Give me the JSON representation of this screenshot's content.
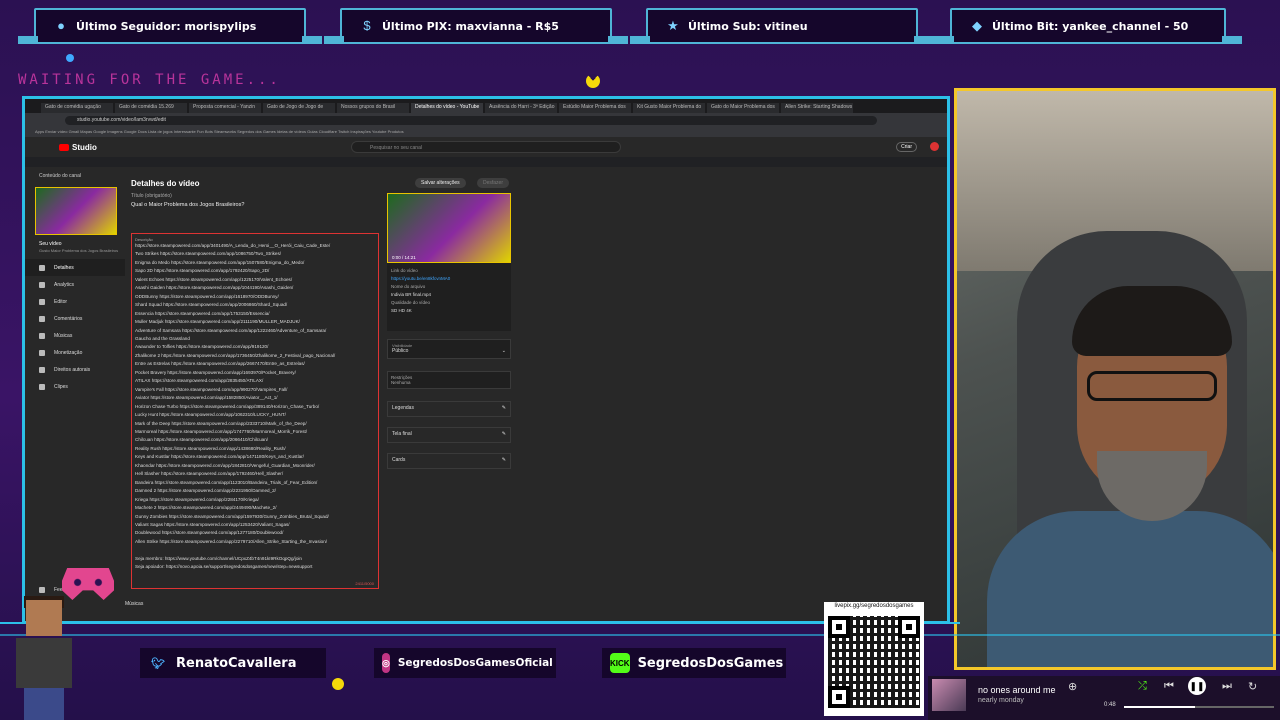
{
  "alerts": [
    {
      "icon": "user-icon",
      "text": "Último Seguidor: morispylips"
    },
    {
      "icon": "pix-icon",
      "text": "Último PIX: maxvianna - R$5"
    },
    {
      "icon": "star-icon",
      "text": "Último Sub: vitineu"
    },
    {
      "icon": "diamond-icon",
      "text": "Último Bit: yankee_channel - 50"
    }
  ],
  "status_text": "WAITING FOR THE GAME...",
  "browser": {
    "tabs": [
      "Gato de comédia ugação",
      "Gato de comédia 15.269",
      "Proposta comercial - Yanzin",
      "Gato de Jogo de Jogo de",
      "Nossos grupos do Brasil",
      "Detalhes do vídeo - YouTube",
      "Ausência do Harri - 3ª Edição",
      "Estúdio Maior Problema dos",
      "Kit Gusto Maior Problema do",
      "Gato do Maior Problema dos",
      "Allen Strike: Starting Shadows"
    ],
    "active_tab": 5,
    "url": "studio.youtube.com/video/lam3rvwd/edit",
    "bookmarks": "Apps  Enviar vídeo  Gmail  Mapas  Google Imagens  Google Docs  Lista de jogos  Interessante  Fun Bots  Steamworks  Segredos dos Games  Ideias de vídeos  Guias  Cloudflare  Twitch  Inspirações  Youtube  Produtos"
  },
  "studio": {
    "logo": "Studio",
    "search_placeholder": "Pesquisar no seu canal",
    "create_label": "Criar",
    "sidebar_header": "Conteúdo do canal",
    "video_label": "Seu vídeo",
    "video_subtitle": "Gusto Maior Problema dos Jogos Brasileiros",
    "nav": [
      "Detalhes",
      "Analytics",
      "Editor",
      "Comentários",
      "Músicas",
      "Monetização",
      "Direitos autorais",
      "Clipes"
    ],
    "active_nav": 0,
    "page_title": "Detalhes do vídeo",
    "save_label": "Salvar alterações",
    "undo_label": "Desfazer",
    "title_label": "Título (obrigatório)",
    "title_value": "Qual o Maior Problema dos Jogos Brasileiros?",
    "description_label": "Descrição",
    "description_lines": [
      "https://store.steampowered.com/app/3401490/A_Lenda_do_Heroi__O_Herói_Caiu_Cade_Este/",
      "Two Strikes https://store.steampowered.com/app/1086750/Two_Strikes/",
      "Enigma do Medo https://store.steampowered.com/app/1507580/Enigma_do_Medo/",
      "Sapo 2D https://store.steampowered.com/app/1792420/Sapo_2D/",
      "Valent Echoes https://store.steampowered.com/app/1225170/Valent_Echoes/",
      "Asashi Gaiden https://store.steampowered.com/app/1044190/Asashi_Gaiden/",
      "ODDBunny https://store.steampowered.com/app/1618970/ODDBunny/",
      "Shard Squad https://store.steampowered.com/app/2006860/Shard_Squad/",
      "Essencia https://store.steampowered.com/app/1753150/Essencia/",
      "Muller Madjuk https://store.steampowered.com/app/2111190/MULLER_MADJUK/",
      "Adventure of Samsara https://store.steampowered.com/app/1222460/Adventure_of_Samsara/",
      "Gaucho and the Grassland",
      "Awaunder to Tolfies https://store.steampowered.com/app/919120/",
      "Zhalikome 2 https://store.steampowered.com/app/1736450/Zhalikome_2_Festival_pago_Nacional/",
      "Entre as Estrelas https://store.steampowered.com/app/2667470/Entre_as_Estrelas/",
      "Pocket Bravery https://store.steampowered.com/app/1693970/Pocket_Bravery/",
      "ATILAX https://store.steampowered.com/app/2835450/ATILAX/",
      "Vampire's Fall https://store.steampowered.com/app/990270/Vampires_Fall/",
      "Aviator https://store.steampowered.com/app/1582850/Aviator__Act_1/",
      "Horizon Chase Turbo https://store.steampowered.com/app/389140/Horizon_Chase_Turbo/",
      "Lucky Hunt https://store.steampowered.com/app/1062310/LUCKY_HUNT/",
      "Mark of the Deep https://store.steampowered.com/app/2333710/Mark_of_the_Deep/",
      "Marmoreal https://store.steampowered.com/app/1747760/Marmoreal_Morrik_Forest/",
      "Chilcuan https://store.steampowered.com/app/2066410/Chilcuan/",
      "Reality Rush https://store.steampowered.com/app/1438680/Reality_Rush/",
      "Keys and Kustlar https://store.steampowered.com/app/1471180/Keys_and_Kustlar/",
      "Khaondar https://store.steampowered.com/app/1842810/Vengeful_Guardian_Moonrider/",
      "Hell Slasher https://store.steampowered.com/app/1792460/Hell_Slasher/",
      "Bandeira https://store.steampowered.com/app/1123010/Bandeira_Trials_of_Fear_Edition/",
      "Damned 2 https://store.steampowered.com/app/2231950/Damned_2/",
      "Kriega https://store.steampowered.com/app/2284170/Kriega/",
      "Machete 2 https://store.steampowered.com/app/2449490/Machete_2/",
      "Gunny Zombies https://store.steampowered.com/app/1597930/Gunny_Zombies_Brutal_Squad/",
      "Valiant Sagas https://store.steampowered.com/app/1253420/Valiant_Sagas/",
      "Doublewood https://store.steampowered.com/app/1277180/Doublewood/",
      "Allen Strike https://store.steampowered.com/app/2279710/Allen_Strike_Starting_the_Invasion/",
      "",
      "Seja membro: https://www.youtube.com/channel/UCpxZ4bT4n91kI9RkOqpQg/join",
      "Seja apoiador: https://novo.apoia.se/support/segredosdosgames/new/step=newsupport"
    ],
    "description_counter": "2411/5000",
    "video_link_label": "Link do vídeo",
    "video_link": "https://youtu.be/en8kfcvnMA0",
    "filename_label": "Nome do arquivo",
    "filename": "Indivia BR final.mp4",
    "quality_label": "Qualidade do vídeo",
    "quality": "SD  HD  4K",
    "preview_time": "0:00 / 14:21",
    "visibility_label": "Visibilidade",
    "visibility": "Público",
    "restrictions_label": "Restrições",
    "restrictions": "Nenhuma",
    "rows": [
      "Legendas",
      "Tela final",
      "Cards"
    ],
    "feedback_label": "Feedback",
    "bottom_tab": "Músicas"
  },
  "socials": [
    {
      "icon": "twitter-icon",
      "text": "RenatoCavallera"
    },
    {
      "icon": "instagram-icon",
      "text": "SegredosDosGamesOficial"
    },
    {
      "icon": "kick-icon",
      "text": "SegredosDosGames"
    }
  ],
  "qr_label": "livepix.gg/segredosdosgames",
  "music": {
    "song": "no ones around me",
    "artist": "nearly monday",
    "elapsed": "0:48",
    "progress": 0.47
  },
  "colors": {
    "accent_cyan": "#2cc0e8",
    "webcam_border": "#f4c72a",
    "status_pink": "#d13aa7",
    "yt_red": "#ff0000"
  }
}
